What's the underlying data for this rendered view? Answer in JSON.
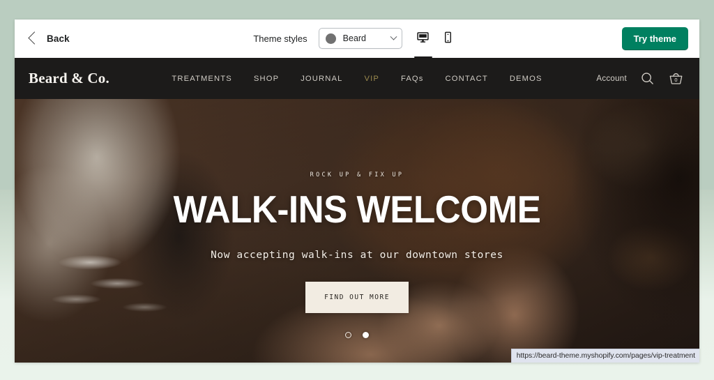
{
  "toolbar": {
    "back_label": "Back",
    "back_icon": "chevron-left-icon",
    "theme_styles_label": "Theme styles",
    "style_select": {
      "selected": "Beard",
      "swatch_color": "#717171",
      "chevron_icon": "chevron-down-icon"
    },
    "view_desktop_icon": "desktop-monitor-icon",
    "view_mobile_icon": "mobile-phone-icon",
    "try_theme_label": "Try theme",
    "try_theme_color": "#008060"
  },
  "site_header": {
    "brand": "Beard & Co.",
    "nav": [
      {
        "label": "TREATMENTS",
        "accent": false
      },
      {
        "label": "SHOP",
        "accent": false
      },
      {
        "label": "JOURNAL",
        "accent": false
      },
      {
        "label": "VIP",
        "accent": true
      },
      {
        "label": "FAQs",
        "accent": false
      },
      {
        "label": "CONTACT",
        "accent": false
      },
      {
        "label": "DEMOS",
        "accent": false
      }
    ],
    "accent_color": "#9c8b4f",
    "background_color": "#1c1b1a",
    "account_label": "Account",
    "search_icon": "search-magnifier-icon",
    "cart_icon": "shopping-basket-icon",
    "cart_count": "0"
  },
  "hero": {
    "eyebrow": "ROCK UP & FIX UP",
    "title": "WALK-INS WELCOME",
    "subtitle": "Now accepting walk-ins at our downtown stores",
    "cta_label": "FIND OUT MORE",
    "cta_bg_color": "#f2ece2",
    "slides": [
      {
        "state": "loading-ring"
      },
      {
        "state": "active"
      }
    ]
  },
  "status_bar": {
    "url": "https://beard-theme.myshopify.com/pages/vip-treatment"
  },
  "page": {
    "background_top_color": "#bacdc0",
    "background_bottom_color": "#e9f2ea"
  }
}
